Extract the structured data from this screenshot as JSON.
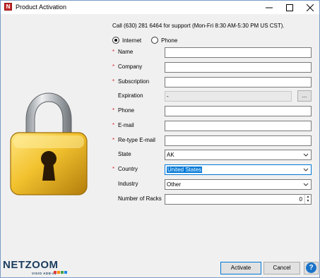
{
  "window": {
    "title": "Product Activation",
    "app_icon_letter": "N"
  },
  "support_text": "Call (630) 281 6464 for support (Mon-Fri 8:30 AM-5:30 PM US CST).",
  "connection": {
    "options": [
      {
        "label": "Internet",
        "selected": true
      },
      {
        "label": "Phone",
        "selected": false
      }
    ]
  },
  "form": {
    "fields": [
      {
        "label": "Name",
        "required": true,
        "value": ""
      },
      {
        "label": "Company",
        "required": true,
        "value": ""
      },
      {
        "label": "Subscription",
        "required": true,
        "value": ""
      },
      {
        "label": "Expiration",
        "required": false,
        "value": "-",
        "browse_label": "..."
      },
      {
        "label": "Phone",
        "required": true,
        "value": ""
      },
      {
        "label": "E-mail",
        "required": true,
        "value": ""
      },
      {
        "label": "Re-type E-mail",
        "required": true,
        "value": ""
      },
      {
        "label": "State",
        "required": false,
        "value": "AK"
      },
      {
        "label": "Country",
        "required": true,
        "value": "United States"
      },
      {
        "label": "Industry",
        "required": false,
        "value": "Other"
      },
      {
        "label": "Number of Racks",
        "required": false,
        "value": "0"
      }
    ],
    "required_marker": "*"
  },
  "footer": {
    "logo_text": "NETZOOM",
    "logo_subtext": "VISIO ADD-IN",
    "activate_label": "Activate",
    "cancel_label": "Cancel",
    "help_label": "?"
  },
  "colors": {
    "required_marker": "#e0282f",
    "accent": "#0078d7",
    "padlock_gold": "#e8b923",
    "padlock_steel": "#b8bcc0",
    "logo_navy": "#1b3d5e",
    "help_blue": "#1a73c9"
  },
  "icons": {
    "app": "netzoom-app-icon",
    "minimize": "minimize-icon",
    "maximize": "maximize-icon",
    "close": "close-icon",
    "padlock": "padlock-icon",
    "dropdown": "chevron-down-icon",
    "spin": "spin-arrows-icon",
    "help": "help-icon"
  }
}
